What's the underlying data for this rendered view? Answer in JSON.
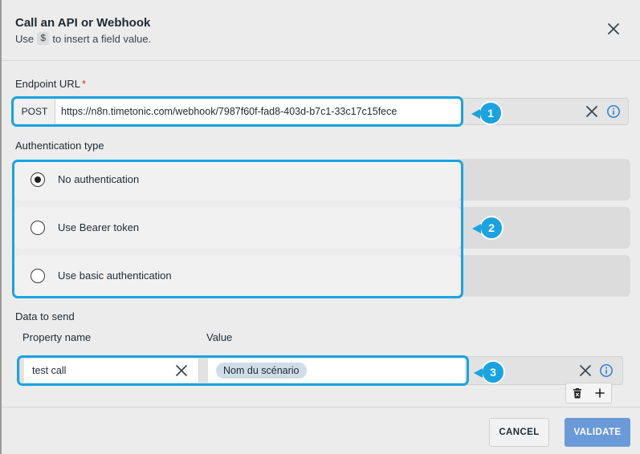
{
  "dialog": {
    "title": "Call an API or Webhook",
    "subtitle_before": "Use",
    "subtitle_code": "$",
    "subtitle_after": "to insert a field value."
  },
  "endpoint": {
    "label": "Endpoint URL",
    "required_mark": "*",
    "method": "POST",
    "url": "https://n8n.timetonic.com/webhook/7987f60f-fad8-403d-b7c1-33c17c15fece"
  },
  "auth": {
    "label": "Authentication type",
    "options": [
      {
        "label": "No authentication",
        "selected": true
      },
      {
        "label": "Use Bearer token",
        "selected": false
      },
      {
        "label": "Use basic authentication",
        "selected": false
      }
    ]
  },
  "data_to_send": {
    "label": "Data to send",
    "col_property": "Property name",
    "col_value": "Value",
    "rows": [
      {
        "property": "test call",
        "value_pill": "Nom du scénario"
      }
    ]
  },
  "annotations": [
    "1",
    "2",
    "3"
  ],
  "footer": {
    "cancel_label": "CANCEL",
    "validate_label": "VALIDATE"
  },
  "colors": {
    "highlight": "#1aa3e0",
    "info_icon": "#2f7fd1",
    "validate_bg": "#6b9ad8",
    "pill_bg": "#cfdde8",
    "required": "#d92d2d"
  },
  "icons": [
    "close-icon",
    "clear-icon",
    "info-icon",
    "delete-icon",
    "plus-icon"
  ]
}
